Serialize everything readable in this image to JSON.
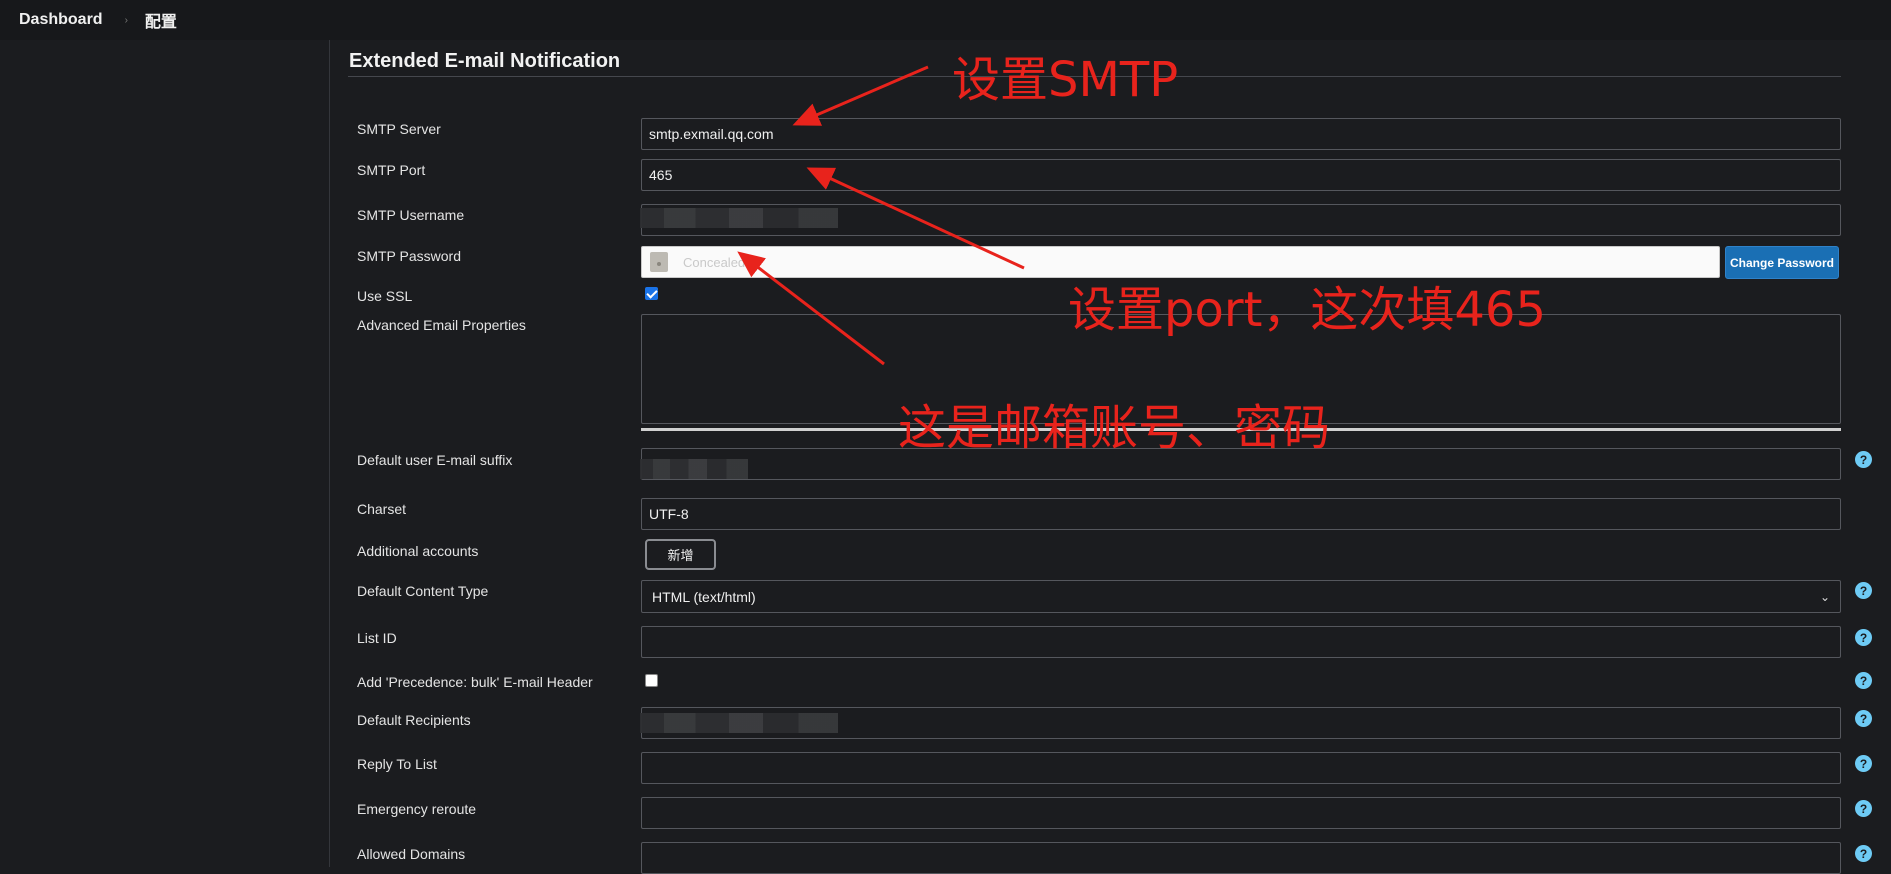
{
  "breadcrumb": {
    "dashboard": "Dashboard",
    "separator": "›",
    "current": "配置"
  },
  "section": {
    "title": "Extended E-mail Notification"
  },
  "fields": {
    "smtp_server": {
      "label": "SMTP Server",
      "value": "smtp.exmail.qq.com"
    },
    "smtp_port": {
      "label": "SMTP Port",
      "value": "465"
    },
    "smtp_username": {
      "label": "SMTP Username"
    },
    "smtp_password": {
      "label": "SMTP Password",
      "placeholder": "Concealed",
      "change_label": "Change Password"
    },
    "use_ssl": {
      "label": "Use SSL",
      "checked": true
    },
    "advanced_props": {
      "label": "Advanced Email Properties",
      "value": ""
    },
    "default_suffix": {
      "label": "Default user E-mail suffix"
    },
    "charset": {
      "label": "Charset",
      "value": "UTF-8"
    },
    "additional_accounts": {
      "label": "Additional accounts",
      "button": "新增"
    },
    "content_type": {
      "label": "Default Content Type",
      "value": "HTML (text/html)"
    },
    "list_id": {
      "label": "List ID",
      "value": ""
    },
    "precedence_bulk": {
      "label": "Add 'Precedence: bulk' E-mail Header",
      "checked": false
    },
    "default_recipients": {
      "label": "Default Recipients"
    },
    "reply_to": {
      "label": "Reply To List",
      "value": ""
    },
    "emergency_reroute": {
      "label": "Emergency reroute",
      "value": ""
    },
    "allowed_domains": {
      "label": "Allowed Domains",
      "value": ""
    }
  },
  "help": {
    "glyph": "?"
  },
  "annotations": {
    "smtp": "设置SMTP",
    "port": "设置port，这次填465",
    "account": "这是邮箱账号、密码",
    "color": "#e8231c"
  },
  "icons": [
    "lock-icon",
    "help-icon",
    "chevron-down-icon",
    "chevron-right-icon"
  ]
}
